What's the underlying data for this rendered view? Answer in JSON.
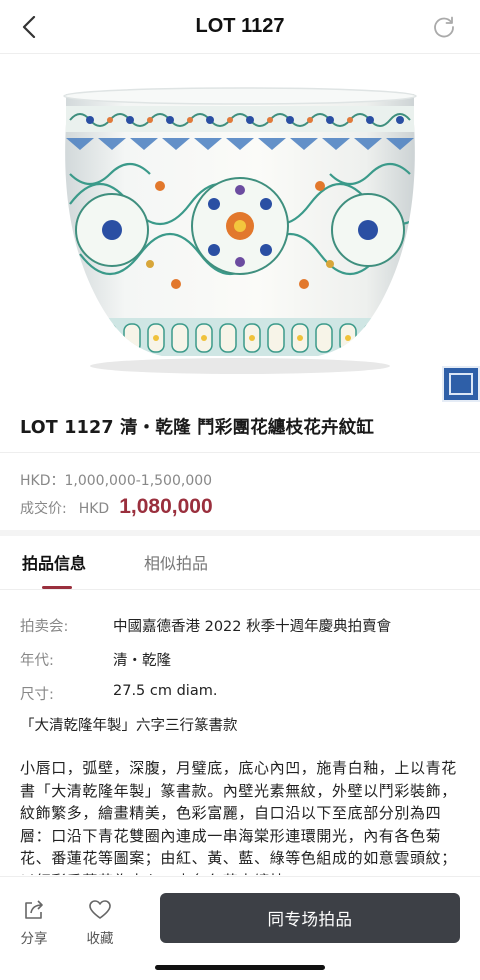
{
  "header": {
    "title": "LOT 1127",
    "back_icon": "chevron-left-icon",
    "refresh_icon": "refresh-icon"
  },
  "lot": {
    "title": "LOT 1127 清・乾隆  鬥彩團花纏枝花卉紋缸",
    "estimate": "HKD：1,000,000-1,500,000",
    "sold_label": "成交价:",
    "sold_currency": "HKD",
    "sold_amount": "1,080,000"
  },
  "tabs": [
    {
      "label": "拍品信息",
      "active": true
    },
    {
      "label": "相似拍品",
      "active": false
    }
  ],
  "details": {
    "sale_label": "拍卖会:",
    "sale_value": "中國嘉德香港 2022 秋季十週年慶典拍賣會",
    "period_label": "年代:",
    "period_value": "清・乾隆",
    "size_label": "尺寸:",
    "size_value": "27.5 cm diam.",
    "mark": "「大清乾隆年製」六字三行篆書款",
    "description": "小唇口，弧壁，深腹，月璧底，底心內凹，施青白釉，上以青花書「大清乾隆年製」篆書款。內壁光素無紋，外壁以鬥彩裝飾，紋飾繁多，繪畫精美，色彩富麗，自口沿以下至底部分別為四層：口沿下青花雙圈內連成一串海棠形連環開光，內有各色菊花、番蓮花等圖案；由紅、黃、藍、綠等色組成的如意雲頭紋；以紅彩番蓮花為中心，由各色花卉纏枝"
  },
  "bottom_bar": {
    "share_label": "分享",
    "favorite_label": "收藏",
    "cta_label": "同专场拍品",
    "share_icon": "share-icon",
    "favorite_icon": "heart-icon"
  },
  "colors": {
    "accent": "#9a2f3d",
    "cta_bg": "#3d4046"
  }
}
